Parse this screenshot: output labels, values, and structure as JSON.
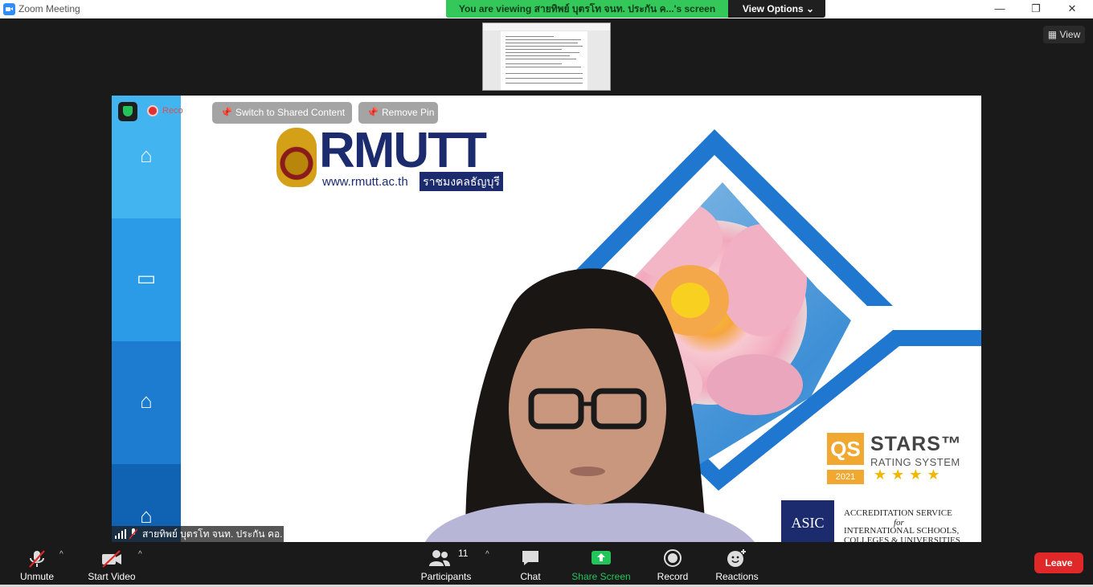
{
  "window": {
    "title": "Zoom Meeting",
    "minimize": "—",
    "restore": "❐",
    "close": "✕"
  },
  "share_banner": {
    "message": "You are viewing สายทิพย์  บุตรโท จนท. ประกัน ค...'s screen",
    "view_options": "View Options",
    "view_options_caret": "⌄"
  },
  "view_button": {
    "label": "View"
  },
  "shared_content": {
    "switch_label": "Switch to Shared Content",
    "remove_pin_label": "Remove Pin",
    "recording_label": "Reco",
    "logo_word": "RMUTT",
    "logo_url": "www.rmutt.ac.th",
    "logo_tag": "ราชมงคลธัญบุรี",
    "qs_box": "QS",
    "qs_stars": "STARS™",
    "qs_rating": "RATING SYSTEM",
    "qs_year": "2021",
    "qs_star_glyphs": "★★★★",
    "asic_mark": "ASIC",
    "asic_line1": "ACCREDITATION SERVICE",
    "asic_line2": "for",
    "asic_line3": "INTERNATIONAL SCHOOLS,",
    "asic_line4": "COLLEGES & UNIVERSITIES"
  },
  "participant": {
    "name": "สายทิพย์  บุตรโท จนท. ประกัน คอ."
  },
  "toolbar": {
    "unmute": "Unmute",
    "start_video": "Start Video",
    "participants": "Participants",
    "participants_count": "11",
    "chat": "Chat",
    "share_screen": "Share Screen",
    "record": "Record",
    "reactions": "Reactions",
    "leave": "Leave",
    "caret": "^"
  },
  "colors": {
    "accent_green": "#34c759",
    "leave_red": "#e02828",
    "logo_navy": "#1c2b6e",
    "diamond_blue": "#1f77d0"
  }
}
